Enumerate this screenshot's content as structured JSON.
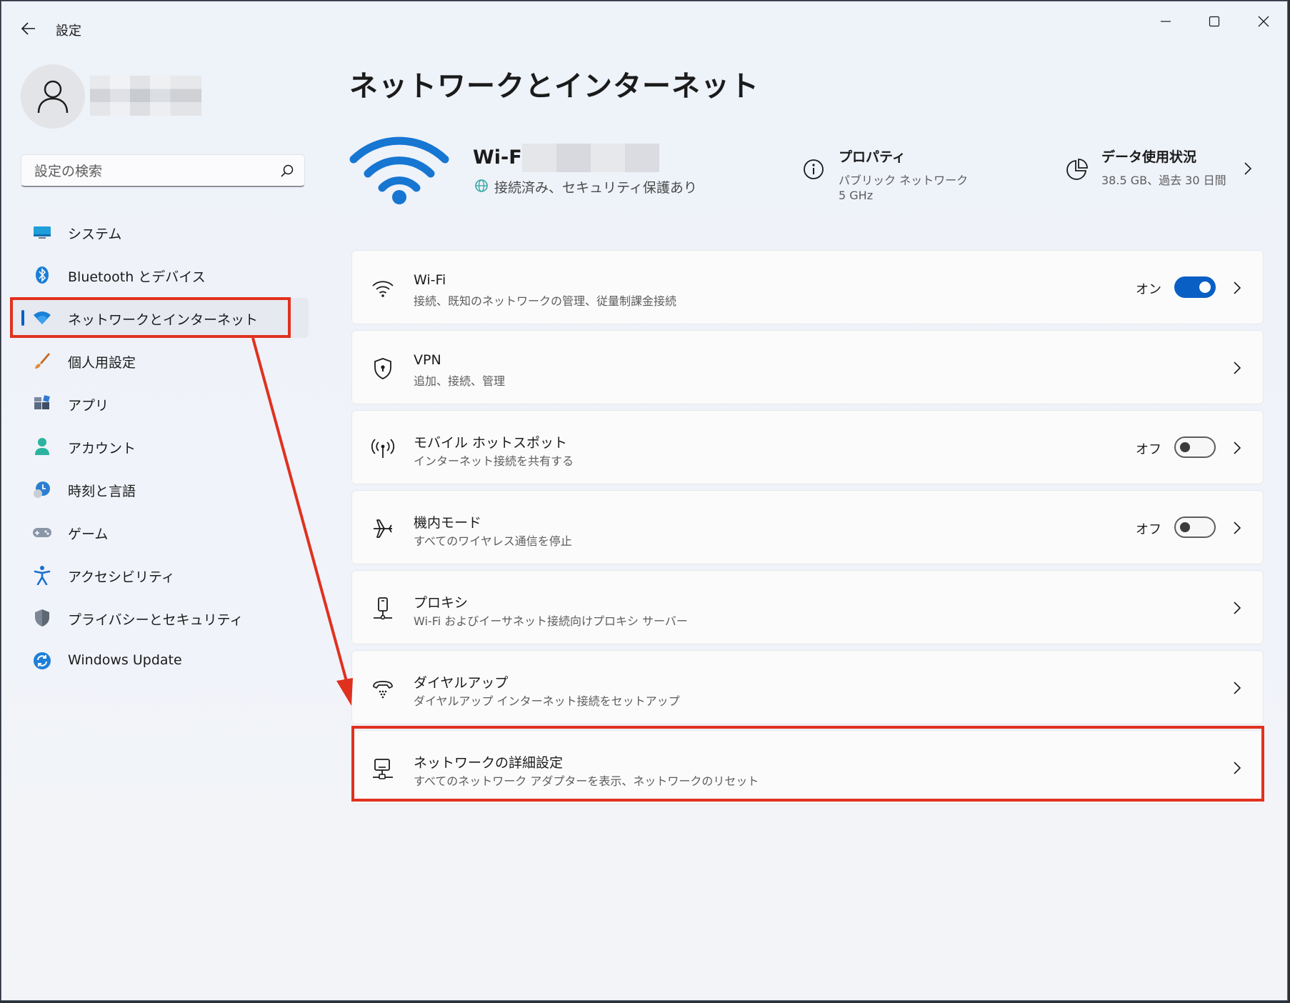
{
  "window": {
    "app_title": "設定"
  },
  "search": {
    "placeholder": "設定の検索"
  },
  "sidebar": {
    "items": [
      {
        "label": "システム"
      },
      {
        "label": "Bluetooth とデバイス"
      },
      {
        "label": "ネットワークとインターネット",
        "active": true
      },
      {
        "label": "個人用設定"
      },
      {
        "label": "アプリ"
      },
      {
        "label": "アカウント"
      },
      {
        "label": "時刻と言語"
      },
      {
        "label": "ゲーム"
      },
      {
        "label": "アクセシビリティ"
      },
      {
        "label": "プライバシーとセキュリティ"
      },
      {
        "label": "Windows Update"
      }
    ]
  },
  "main": {
    "title": "ネットワークとインターネット",
    "hero": {
      "ssid_label": "Wi-Fi",
      "status": "接続済み、セキュリティ保護あり",
      "properties": {
        "title": "プロパティ",
        "line1": "パブリック ネットワーク",
        "line2": "5 GHz"
      },
      "usage": {
        "title": "データ使用状況",
        "sub": "38.5 GB、過去 30 日間"
      }
    },
    "cards": [
      {
        "title": "Wi-Fi",
        "sub": "接続、既知のネットワークの管理、従量制課金接続",
        "state": "オン",
        "toggle": "on"
      },
      {
        "title": "VPN",
        "sub": "追加、接続、管理"
      },
      {
        "title": "モバイル ホットスポット",
        "sub": "インターネット接続を共有する",
        "state": "オフ",
        "toggle": "off"
      },
      {
        "title": "機内モード",
        "sub": "すべてのワイヤレス通信を停止",
        "state": "オフ",
        "toggle": "off"
      },
      {
        "title": "プロキシ",
        "sub": "Wi-Fi およびイーサネット接続向けプロキシ サーバー"
      },
      {
        "title": "ダイヤルアップ",
        "sub": "ダイヤルアップ インターネット接続をセットアップ"
      },
      {
        "title": "ネットワークの詳細設定",
        "sub": "すべてのネットワーク アダプターを表示、ネットワークのリセット"
      }
    ]
  },
  "colors": {
    "accent": "#0a5fc4",
    "annotation": "#e0311f"
  }
}
